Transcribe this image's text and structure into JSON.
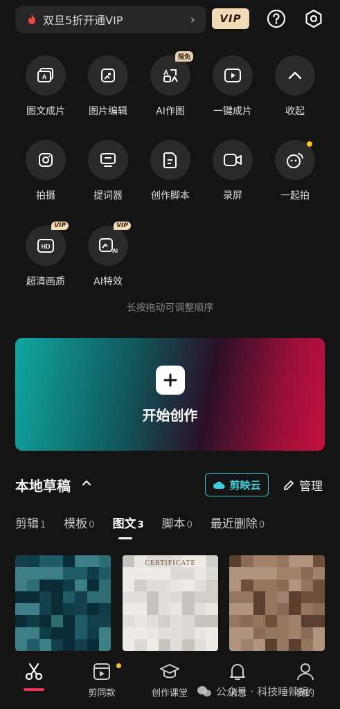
{
  "top": {
    "vip_promo": "双旦5折开通VIP",
    "vip_badge": "VIP"
  },
  "tools": [
    {
      "label": "图文成片",
      "icon": "image-text-icon"
    },
    {
      "label": "图片编辑",
      "icon": "image-edit-icon"
    },
    {
      "label": "AI作图",
      "icon": "ai-draw-icon",
      "tag": "限免"
    },
    {
      "label": "一键成片",
      "icon": "play-video-icon"
    },
    {
      "label": "收起",
      "icon": "collapse-up-icon"
    },
    {
      "label": "拍摄",
      "icon": "camera-icon"
    },
    {
      "label": "提词器",
      "icon": "teleprompter-icon"
    },
    {
      "label": "创作脚本",
      "icon": "script-icon"
    },
    {
      "label": "录屏",
      "icon": "screen-record-icon"
    },
    {
      "label": "一起拍",
      "icon": "together-shoot-icon"
    },
    {
      "label": "超清画质",
      "icon": "hd-icon",
      "tag": "VIP"
    },
    {
      "label": "AI特效",
      "icon": "ai-effect-icon",
      "tag": "VIP"
    }
  ],
  "hint": "长按拖动可调整顺序",
  "start": {
    "title": "开始创作"
  },
  "drafts": {
    "title": "本地草稿",
    "cloud": "剪映云",
    "manage": "管理",
    "tabs": [
      {
        "label": "剪辑",
        "count": "1"
      },
      {
        "label": "模板",
        "count": "0"
      },
      {
        "label": "图文",
        "count": "3"
      },
      {
        "label": "脚本",
        "count": "0"
      },
      {
        "label": "最近删除",
        "count": "0"
      }
    ],
    "thumb_text": "CERTIFICATE"
  },
  "nav": [
    {
      "label": "",
      "icon": "scissors-icon"
    },
    {
      "label": "剪同款",
      "icon": "template-icon"
    },
    {
      "label": "创作课堂",
      "icon": "graduation-cap-icon"
    },
    {
      "label": "消息",
      "icon": "bell-icon"
    },
    {
      "label": "我的",
      "icon": "user-icon"
    }
  ],
  "watermark": "公众号 · 科技睡辣搞"
}
